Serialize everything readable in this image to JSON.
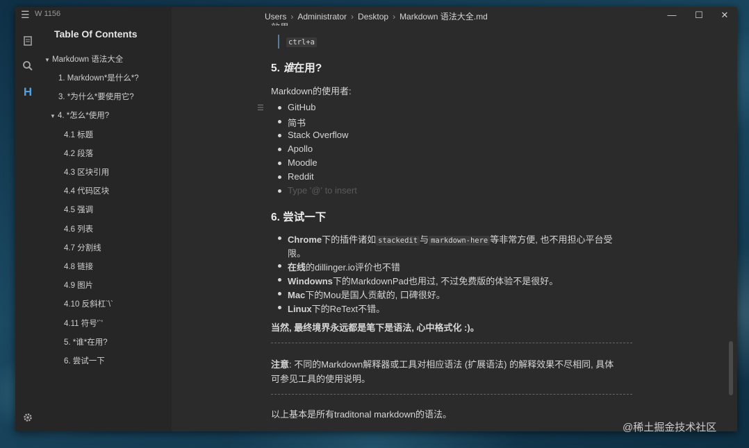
{
  "window": {
    "word_count": "W 1156",
    "breadcrumb": [
      "Users",
      "Administrator",
      "Desktop",
      "Markdown 语法大全.md"
    ]
  },
  "activity_bar": {
    "icons": [
      "files-icon",
      "search-icon",
      "outline-heading-icon",
      "settings-icon"
    ],
    "heading_glyph": "H"
  },
  "toc": {
    "title": "Table Of Contents",
    "items": [
      "Markdown 语法大全",
      "1. Markdown*是什么*?",
      "3. *为什么*要使用它?",
      "4. *怎么*使用?",
      "4.1 标题",
      "4.2 段落",
      "4.3 区块引用",
      "4.4 代码区块",
      "4.5 强调",
      "4.6 列表",
      "4.7 分割线",
      "4.8 链接",
      "4.9 图片",
      "4.10 反斜杠`\\`",
      "4.11 符号'`'",
      "5. *谁*在用?",
      "6. 尝试一下"
    ]
  },
  "doc": {
    "top_cut": "效果:",
    "quote_code": "ctrl+a",
    "h5_num": "5. ",
    "h5_em": "谁",
    "h5_rest": "在用?",
    "users_intro": "Markdown的使用者:",
    "users": [
      "GitHub",
      "简书",
      "Stack Overflow",
      "Apollo",
      "Moodle",
      "Reddit"
    ],
    "placeholder": "Type '@' to insert",
    "h6": "6. 尝试一下",
    "tries": [
      {
        "bold": "Chrome",
        "t1": "下的插件诸如",
        "c1": "stackedit",
        "t2": "与",
        "c2": "markdown-here",
        "t3": "等非常方便, 也不用担心平台受",
        "t4": "限。"
      },
      {
        "bold": "在线",
        "text": "的dillinger.io评价也不错"
      },
      {
        "bold": "Windowns",
        "text": "下的MarkdownPad也用过, 不过免费版的体验不是很好。"
      },
      {
        "bold": "Mac",
        "text": "下的Mou是国人贡献的, 口碑很好。"
      },
      {
        "bold": "Linux",
        "text": "下的ReText不错。"
      }
    ],
    "final_bold": "当然, 最终境界永远都是笔下是语法, 心中格式化 :)。",
    "note_label": "注意",
    "note_line1": ": 不同的Markdown解释器或工具对相应语法 (扩展语法) 的解释效果不尽相同, 具体",
    "note_line2": "可参见工具的使用说明。",
    "closing": "以上基本是所有traditonal markdown的语法。"
  },
  "watermark": "@稀土掘金技术社区",
  "colors": {
    "accent": "#4fa2e0",
    "background": "#2b2b2b",
    "sidebar": "#262626"
  }
}
